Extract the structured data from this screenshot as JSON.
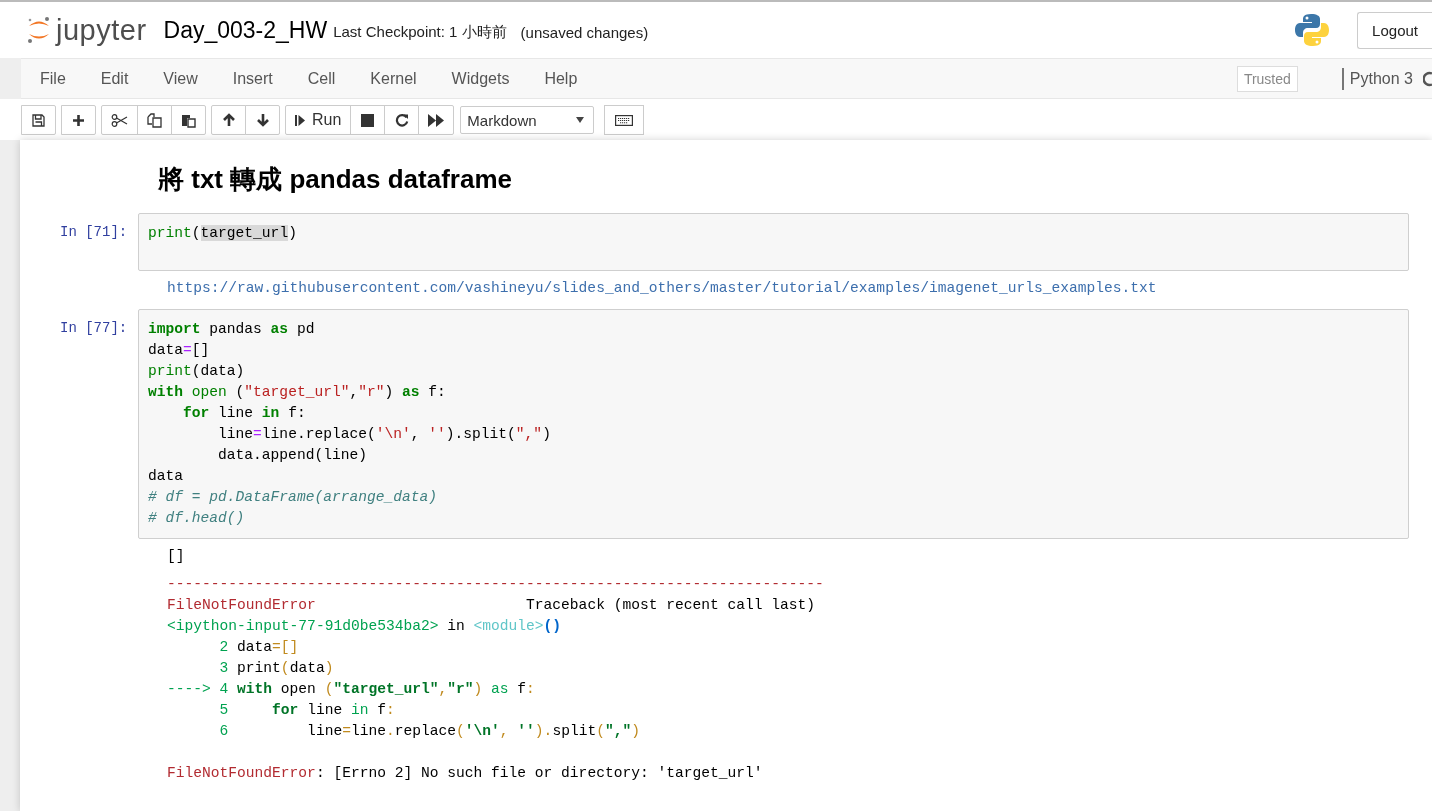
{
  "header": {
    "logo_text": "jupyter",
    "notebook_name": "Day_003-2_HW",
    "checkpoint": "Last Checkpoint: 1 小時前",
    "save_status": "(unsaved changes)",
    "logout": "Logout"
  },
  "menubar": {
    "items": [
      "File",
      "Edit",
      "View",
      "Insert",
      "Cell",
      "Kernel",
      "Widgets",
      "Help"
    ],
    "trusted": "Trusted",
    "kernel": "Python 3"
  },
  "toolbar": {
    "run_label": "Run",
    "cell_type": "Markdown"
  },
  "cells": [
    {
      "kind": "markdown",
      "heading": "將 txt 轉成 pandas dataframe"
    },
    {
      "kind": "code",
      "prompt": "In [71]:",
      "lines": [
        [
          {
            "kind": "builtin",
            "text": "print"
          },
          {
            "kind": "plain",
            "text": "("
          },
          {
            "kind": "selection",
            "text": "target_url"
          },
          {
            "kind": "plain",
            "text": ")"
          }
        ]
      ],
      "outputs": [
        {
          "lines": [
            [
              {
                "kind": "link",
                "text": "https://raw.githubusercontent.com/vashineyu/slides_and_others/master/tutorial/examples/imagenet_urls_examples.txt"
              }
            ]
          ]
        }
      ]
    },
    {
      "kind": "code",
      "prompt": "In [77]:",
      "lines": [
        [
          {
            "kind": "keyword",
            "text": "import"
          },
          {
            "kind": "plain",
            "text": " pandas "
          },
          {
            "kind": "keyword",
            "text": "as"
          },
          {
            "kind": "plain",
            "text": " pd"
          }
        ],
        [
          {
            "kind": "plain",
            "text": "data"
          },
          {
            "kind": "operator",
            "text": "="
          },
          {
            "kind": "plain",
            "text": "[]"
          }
        ],
        [
          {
            "kind": "builtin",
            "text": "print"
          },
          {
            "kind": "plain",
            "text": "(data)"
          }
        ],
        [
          {
            "kind": "keyword",
            "text": "with"
          },
          {
            "kind": "builtin",
            "text": " open"
          },
          {
            "kind": "plain",
            "text": " ("
          },
          {
            "kind": "string",
            "text": "\"target_url\""
          },
          {
            "kind": "plain",
            "text": ","
          },
          {
            "kind": "string",
            "text": "\"r\""
          },
          {
            "kind": "plain",
            "text": ") "
          },
          {
            "kind": "keyword",
            "text": "as"
          },
          {
            "kind": "plain",
            "text": " f:"
          }
        ],
        [
          {
            "kind": "keyword",
            "text": "    for"
          },
          {
            "kind": "plain",
            "text": " line "
          },
          {
            "kind": "keyword",
            "text": "in"
          },
          {
            "kind": "plain",
            "text": " f:"
          }
        ],
        [
          {
            "kind": "plain",
            "text": "        line"
          },
          {
            "kind": "operator",
            "text": "="
          },
          {
            "kind": "plain",
            "text": "line.replace("
          },
          {
            "kind": "string",
            "text": "'\\n'"
          },
          {
            "kind": "plain",
            "text": ", "
          },
          {
            "kind": "string",
            "text": "''"
          },
          {
            "kind": "plain",
            "text": ").split("
          },
          {
            "kind": "string",
            "text": "\",\""
          },
          {
            "kind": "plain",
            "text": ")"
          }
        ],
        [
          {
            "kind": "plain",
            "text": "        data.append(line)"
          }
        ],
        [
          {
            "kind": "plain",
            "text": "data"
          }
        ],
        [
          {
            "kind": "comment",
            "text": "# df = pd.DataFrame(arrange_data)"
          }
        ],
        [
          {
            "kind": "comment",
            "text": "# df.head()"
          }
        ]
      ],
      "outputs": [
        {
          "lines": [
            [
              {
                "kind": "plain",
                "text": "[]"
              }
            ]
          ]
        },
        {
          "lines": [
            [
              {
                "kind": "red",
                "text": "---------------------------------------------------------------------------"
              }
            ],
            [
              {
                "kind": "red",
                "text": "FileNotFoundError"
              },
              {
                "kind": "plain",
                "text": "                        Traceback (most recent call last)"
              }
            ],
            [
              {
                "kind": "green",
                "text": "<ipython-input-77-91d0be534ba2>"
              },
              {
                "kind": "plain",
                "text": " in "
              },
              {
                "kind": "cyan",
                "text": "<module>"
              },
              {
                "kind": "blue",
                "text": "()"
              }
            ],
            [
              {
                "kind": "green",
                "text": "      2 "
              },
              {
                "kind": "plain",
                "text": "data"
              },
              {
                "kind": "yellow",
                "text": "=[]"
              }
            ],
            [
              {
                "kind": "green",
                "text": "      3 "
              },
              {
                "kind": "plain",
                "text": "print"
              },
              {
                "kind": "yellow",
                "text": "("
              },
              {
                "kind": "plain",
                "text": "data"
              },
              {
                "kind": "yellow",
                "text": ")"
              }
            ],
            [
              {
                "kind": "green",
                "text": "----> 4 "
              },
              {
                "kind": "greenbold",
                "text": "with"
              },
              {
                "kind": "plain",
                "text": " open "
              },
              {
                "kind": "yellow",
                "text": "("
              },
              {
                "kind": "greenbold",
                "text": "\"target_url\""
              },
              {
                "kind": "yellow",
                "text": ","
              },
              {
                "kind": "greenbold",
                "text": "\"r\""
              },
              {
                "kind": "yellow",
                "text": ")"
              },
              {
                "kind": "green",
                "text": " as"
              },
              {
                "kind": "plain",
                "text": " f"
              },
              {
                "kind": "yellow",
                "text": ":"
              }
            ],
            [
              {
                "kind": "green",
                "text": "      5 "
              },
              {
                "kind": "greenbold",
                "text": "    for"
              },
              {
                "kind": "plain",
                "text": " line "
              },
              {
                "kind": "green",
                "text": "in"
              },
              {
                "kind": "plain",
                "text": " f"
              },
              {
                "kind": "yellow",
                "text": ":"
              }
            ],
            [
              {
                "kind": "green",
                "text": "      6 "
              },
              {
                "kind": "plain",
                "text": "        line"
              },
              {
                "kind": "yellow",
                "text": "="
              },
              {
                "kind": "plain",
                "text": "line"
              },
              {
                "kind": "yellow",
                "text": "."
              },
              {
                "kind": "plain",
                "text": "replace"
              },
              {
                "kind": "yellow",
                "text": "("
              },
              {
                "kind": "greenbold",
                "text": "'\\n'"
              },
              {
                "kind": "yellow",
                "text": ", "
              },
              {
                "kind": "greenbold",
                "text": "''"
              },
              {
                "kind": "yellow",
                "text": ")."
              },
              {
                "kind": "plain",
                "text": "split"
              },
              {
                "kind": "yellow",
                "text": "("
              },
              {
                "kind": "greenbold",
                "text": "\",\""
              },
              {
                "kind": "yellow",
                "text": ")"
              }
            ]
          ],
          "message": [
            {
              "kind": "red",
              "text": "FileNotFoundError"
            },
            {
              "kind": "plain",
              "text": ": [Errno 2] No such file or directory: 'target_url'"
            }
          ]
        }
      ]
    }
  ]
}
